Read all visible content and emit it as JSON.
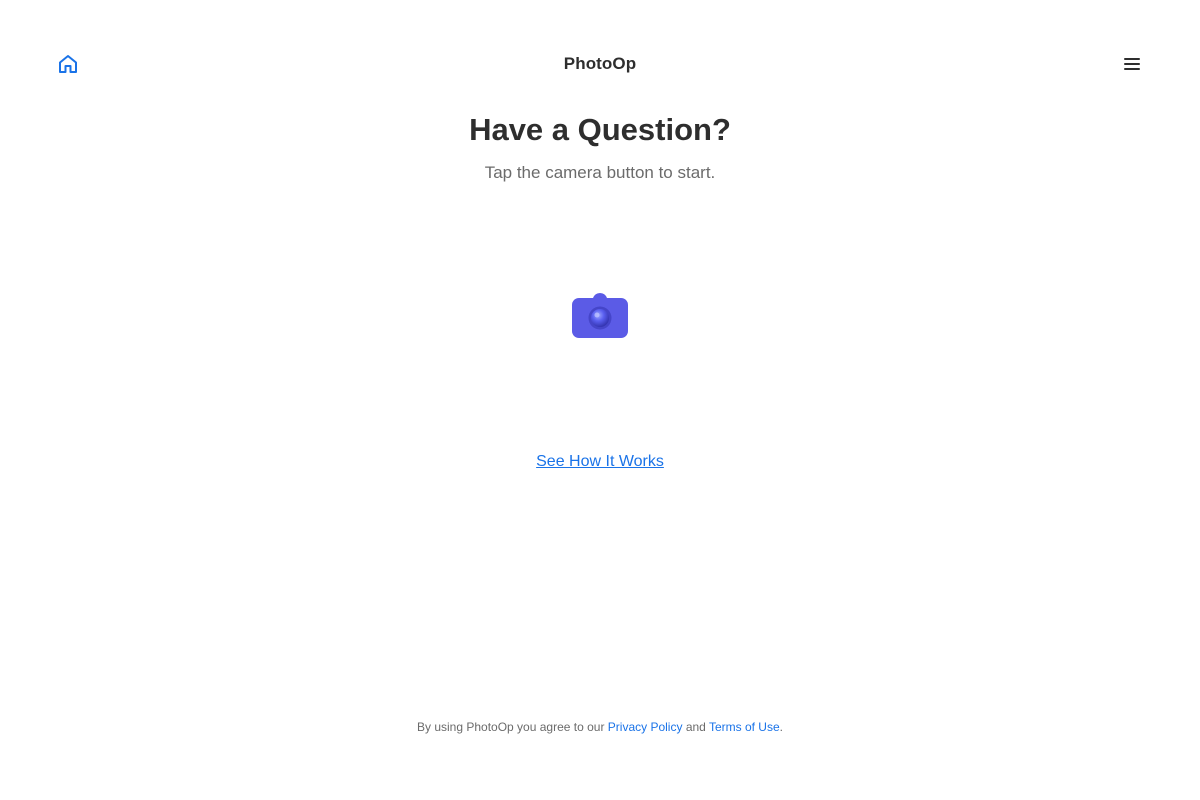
{
  "header": {
    "title": "PhotoOp",
    "home_icon": "home-icon",
    "menu_icon": "hamburger-menu-icon"
  },
  "main": {
    "headline": "Have a Question?",
    "subline": "Tap the camera button to start.",
    "camera_icon": "camera-icon",
    "how_it_works_link": "See How It Works"
  },
  "footer": {
    "prefix": "By using PhotoOp you agree to our",
    "privacy_link": "Privacy Policy",
    "conjunction": "and",
    "terms_link": "Terms of Use",
    "suffix": "."
  },
  "colors": {
    "accent_blue": "#1a73e8",
    "camera_purple": "#5b5be6",
    "text_dark": "#2e2e2e",
    "text_muted": "#6b6b6b"
  }
}
